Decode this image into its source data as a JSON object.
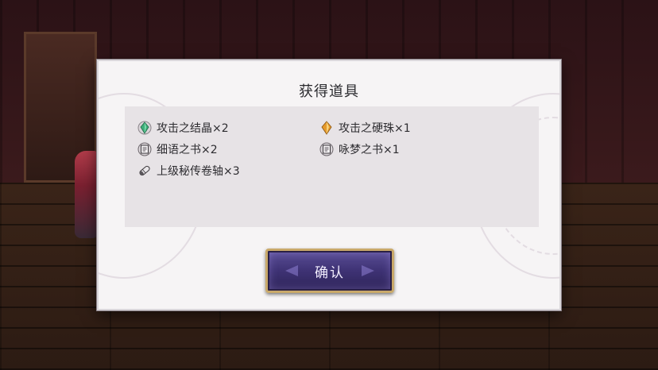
{
  "dialog": {
    "title": "获得道具",
    "confirm_label": "确认"
  },
  "items": [
    {
      "label": "攻击之结晶×2",
      "icon": "green-crystal-icon"
    },
    {
      "label": "攻击之硬珠×1",
      "icon": "orange-gem-icon"
    },
    {
      "label": "细语之书×2",
      "icon": "book-icon"
    },
    {
      "label": "咏梦之书×1",
      "icon": "book-icon"
    },
    {
      "label": "上级秘传卷轴×3",
      "icon": "scroll-icon"
    }
  ],
  "colors": {
    "dialog_bg": "#f6f4f5",
    "panel_bg": "#e7e3e6",
    "button_bg": "#3e3274",
    "button_border": "#c9a96a"
  }
}
